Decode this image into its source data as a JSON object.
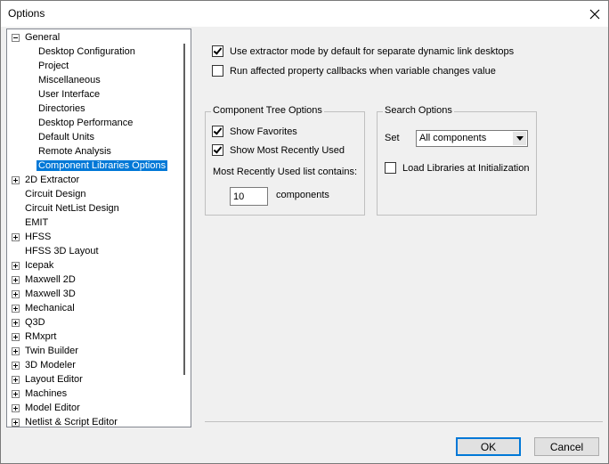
{
  "window": {
    "title": "Options"
  },
  "tree": {
    "items": [
      {
        "label": "General",
        "level": 0,
        "expander": "minus",
        "selected": false
      },
      {
        "label": "Desktop Configuration",
        "level": 1,
        "expander": "none",
        "selected": false
      },
      {
        "label": "Project",
        "level": 1,
        "expander": "none",
        "selected": false
      },
      {
        "label": "Miscellaneous",
        "level": 1,
        "expander": "none",
        "selected": false
      },
      {
        "label": "User Interface",
        "level": 1,
        "expander": "none",
        "selected": false
      },
      {
        "label": "Directories",
        "level": 1,
        "expander": "none",
        "selected": false
      },
      {
        "label": "Desktop Performance",
        "level": 1,
        "expander": "none",
        "selected": false
      },
      {
        "label": "Default Units",
        "level": 1,
        "expander": "none",
        "selected": false
      },
      {
        "label": "Remote Analysis",
        "level": 1,
        "expander": "none",
        "selected": false
      },
      {
        "label": "Component Libraries Options",
        "level": 1,
        "expander": "none",
        "selected": true
      },
      {
        "label": "2D Extractor",
        "level": 0,
        "expander": "plus",
        "selected": false
      },
      {
        "label": "Circuit Design",
        "level": 0,
        "expander": "none",
        "selected": false
      },
      {
        "label": "Circuit NetList Design",
        "level": 0,
        "expander": "none",
        "selected": false
      },
      {
        "label": "EMIT",
        "level": 0,
        "expander": "none",
        "selected": false
      },
      {
        "label": "HFSS",
        "level": 0,
        "expander": "plus",
        "selected": false
      },
      {
        "label": "HFSS 3D Layout",
        "level": 0,
        "expander": "none",
        "selected": false
      },
      {
        "label": "Icepak",
        "level": 0,
        "expander": "plus",
        "selected": false
      },
      {
        "label": "Maxwell 2D",
        "level": 0,
        "expander": "plus",
        "selected": false
      },
      {
        "label": "Maxwell 3D",
        "level": 0,
        "expander": "plus",
        "selected": false
      },
      {
        "label": "Mechanical",
        "level": 0,
        "expander": "plus",
        "selected": false
      },
      {
        "label": "Q3D",
        "level": 0,
        "expander": "plus",
        "selected": false
      },
      {
        "label": "RMxprt",
        "level": 0,
        "expander": "plus",
        "selected": false
      },
      {
        "label": "Twin Builder",
        "level": 0,
        "expander": "plus",
        "selected": false
      },
      {
        "label": "3D Modeler",
        "level": 0,
        "expander": "plus",
        "selected": false
      },
      {
        "label": "Layout Editor",
        "level": 0,
        "expander": "plus",
        "selected": false
      },
      {
        "label": "Machines",
        "level": 0,
        "expander": "plus",
        "selected": false
      },
      {
        "label": "Model Editor",
        "level": 0,
        "expander": "plus",
        "selected": false
      },
      {
        "label": "Netlist & Script Editor",
        "level": 0,
        "expander": "plus",
        "selected": false
      }
    ]
  },
  "options": {
    "extractor_mode": {
      "label": "Use extractor mode by default for separate dynamic link desktops",
      "checked": true
    },
    "affected_callbacks": {
      "label": "Run affected property callbacks when variable changes value",
      "checked": false
    }
  },
  "component_tree": {
    "title": "Component Tree Options",
    "show_favorites": {
      "label": "Show Favorites",
      "checked": true
    },
    "show_mru": {
      "label": "Show Most Recently Used",
      "checked": true
    },
    "mru_label": "Most Recently Used list contains:",
    "mru_count": "10",
    "mru_suffix": "components"
  },
  "search": {
    "title": "Search Options",
    "set_label": "Set",
    "set_value": "All components",
    "load_libraries": {
      "label": "Load Libraries at Initialization",
      "checked": false
    }
  },
  "buttons": {
    "ok": "OK",
    "cancel": "Cancel"
  },
  "colors": {
    "selection": "#0078d7",
    "background": "#f0f0f0"
  }
}
